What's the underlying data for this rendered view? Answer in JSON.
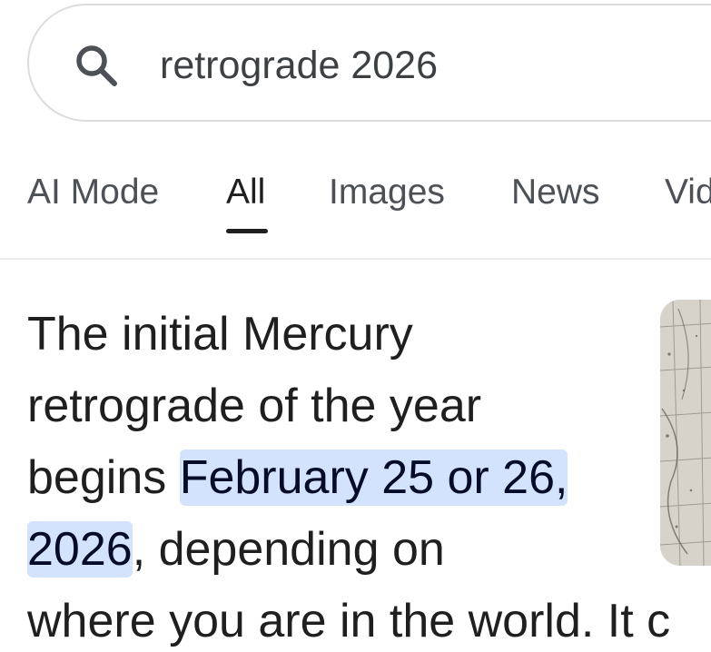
{
  "search": {
    "query": "retrograde 2026",
    "icon": "search-icon"
  },
  "tabs": [
    {
      "label": "AI Mode",
      "active": false
    },
    {
      "label": "All",
      "active": true
    },
    {
      "label": "Images",
      "active": false
    },
    {
      "label": "News",
      "active": false
    },
    {
      "label": "Vid",
      "active": false
    }
  ],
  "answer": {
    "line1": "The initial Mercury",
    "line2": "retrograde of the year",
    "line3_pre": "begins ",
    "highlight_part1": "February 25 or 26,",
    "highlight_part2": "2026",
    "line4_post": ", depending on",
    "line5": "where you are in the world. It c"
  },
  "thumbnail": {
    "icon": "celestial-map-image"
  },
  "colors": {
    "highlight": "#d3e3fd",
    "text": "#1f1f1f",
    "tab_text": "#4d5156",
    "divider": "#ebebeb",
    "search_border": "#dadce0"
  }
}
